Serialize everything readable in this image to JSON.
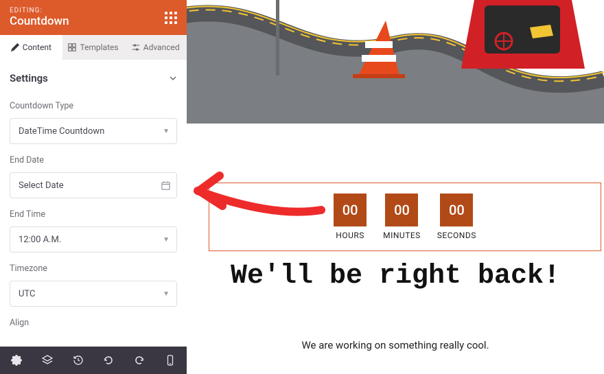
{
  "header": {
    "editing_label": "EDITING:",
    "widget_name": "Countdown"
  },
  "tabs": [
    {
      "label": "Content",
      "icon": "pencil",
      "active": true
    },
    {
      "label": "Templates",
      "icon": "templates",
      "active": false
    },
    {
      "label": "Advanced",
      "icon": "sliders",
      "active": false
    }
  ],
  "settings": {
    "section_title": "Settings",
    "fields": {
      "countdown_type": {
        "label": "Countdown Type",
        "value": "DateTime Countdown"
      },
      "end_date": {
        "label": "End Date",
        "value": "Select Date"
      },
      "end_time": {
        "label": "End Time",
        "value": "12:00 A.M."
      },
      "timezone": {
        "label": "Timezone",
        "value": "UTC"
      },
      "align": {
        "label": "Align"
      }
    }
  },
  "countdown": {
    "hours": {
      "num": "00",
      "label": "HOURS"
    },
    "minutes": {
      "num": "00",
      "label": "MINUTES"
    },
    "seconds": {
      "num": "00",
      "label": "SECONDS"
    }
  },
  "page": {
    "headline": "We'll be right back!",
    "subtext": "We are working on something really cool."
  },
  "colors": {
    "accent": "#dd5a2b",
    "dark": "#3a3742",
    "cd_bg": "#b14a17"
  }
}
